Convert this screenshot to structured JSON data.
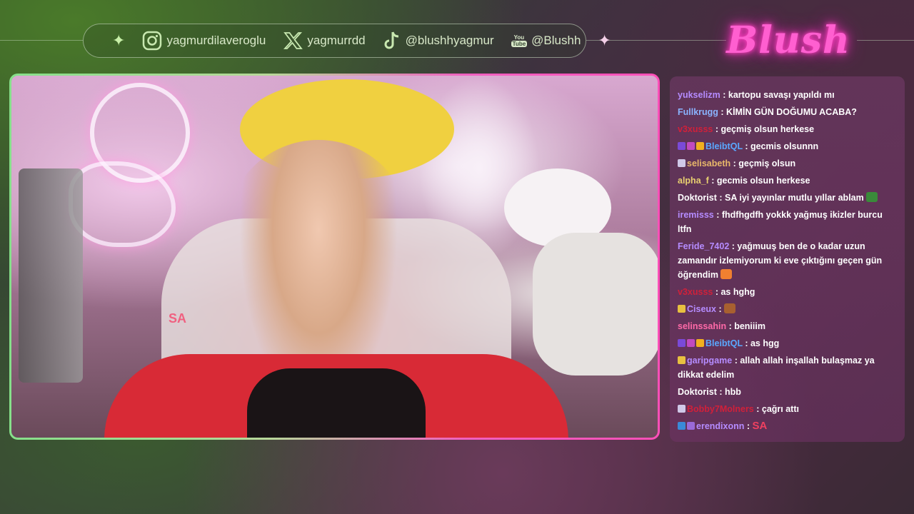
{
  "social_bar": {
    "items": [
      {
        "icon": "instagram-icon",
        "handle": "yagmurdilaveroglu"
      },
      {
        "icon": "x-icon",
        "handle": "yagmurrdd"
      },
      {
        "icon": "tiktok-icon",
        "handle": "@blushhyagmur"
      },
      {
        "icon": "youtube-icon",
        "handle": "@Blushh",
        "icon_text_top": "You",
        "icon_text_bottom": "Tube"
      }
    ]
  },
  "logo": {
    "text": "Blush"
  },
  "video": {
    "overlay_tag": "SA"
  },
  "chat": {
    "messages": [
      {
        "user": "yukselizm",
        "color": "#b58cff",
        "text": ": kartopu savaşı yapıldı mı",
        "badges": []
      },
      {
        "user": "Fullkrugg",
        "color": "#8ab4ff",
        "text": ": KİMİN GÜN DOĞUMU ACABA?",
        "badges": []
      },
      {
        "user": "v3xusss",
        "color": "#d0203a",
        "text": ": geçmiş olsun herkese",
        "badges": []
      },
      {
        "user": "BleibtQL",
        "color": "#5aa8ff",
        "text": ": gecmis olsunnn",
        "badges": [
          "#7a4ad8",
          "#c04ac0",
          "#f0b020"
        ]
      },
      {
        "user": "selisabeth",
        "color": "#e8b86a",
        "text": ": geçmiş olsun",
        "badges": [
          "#d0c8e8"
        ]
      },
      {
        "user": "alpha_f",
        "color": "#e8d070",
        "text": ": gecmis olsun herkese",
        "badges": []
      },
      {
        "user": "Doktorist",
        "color": "#ffffff",
        "text": ": SA iyi yayınlar mutlu yıllar ablam",
        "badges": [],
        "emote": "#3a8a3a"
      },
      {
        "user": "iremisss",
        "color": "#b58cff",
        "text": ": fhdfhgdfh yokkk yağmuş ikizler burcu ltfn",
        "badges": []
      },
      {
        "user": "Feride_7402",
        "color": "#b58cff",
        "text": ": yağmuuş ben de o kadar uzun zamandır izlemiyorum ki eve çıktığını geçen gün öğrendim",
        "badges": [],
        "emote": "#f08030"
      },
      {
        "user": "v3xusss",
        "color": "#d0203a",
        "text": ": as hghg",
        "badges": []
      },
      {
        "user": "Ciseux",
        "color": "#b58cff",
        "text": ":",
        "badges": [
          "#e8c040"
        ],
        "emote": "#a86030"
      },
      {
        "user": "selinssahin",
        "color": "#ff6aa8",
        "text": ": beniiim",
        "badges": []
      },
      {
        "user": "BleibtQL",
        "color": "#5aa8ff",
        "text": ": as hgg",
        "badges": [
          "#7a4ad8",
          "#c04ac0",
          "#f0b020"
        ]
      },
      {
        "user": "garipgame",
        "color": "#b58cff",
        "text": ": allah allah inşallah bulaşmaz ya dikkat edelim",
        "badges": [
          "#e8c040"
        ]
      },
      {
        "user": "Doktorist",
        "color": "#ffffff",
        "text": ": hbb",
        "badges": []
      },
      {
        "user": "Bobby7Molners",
        "color": "#d0203a",
        "text": ": çağrı attı",
        "badges": [
          "#d0c8e8"
        ]
      },
      {
        "user": "erendixonn",
        "color": "#b58cff",
        "text": ":",
        "badges": [
          "#3a8ad8",
          "#9a6ad8"
        ],
        "sa_emote": "SA"
      }
    ]
  }
}
